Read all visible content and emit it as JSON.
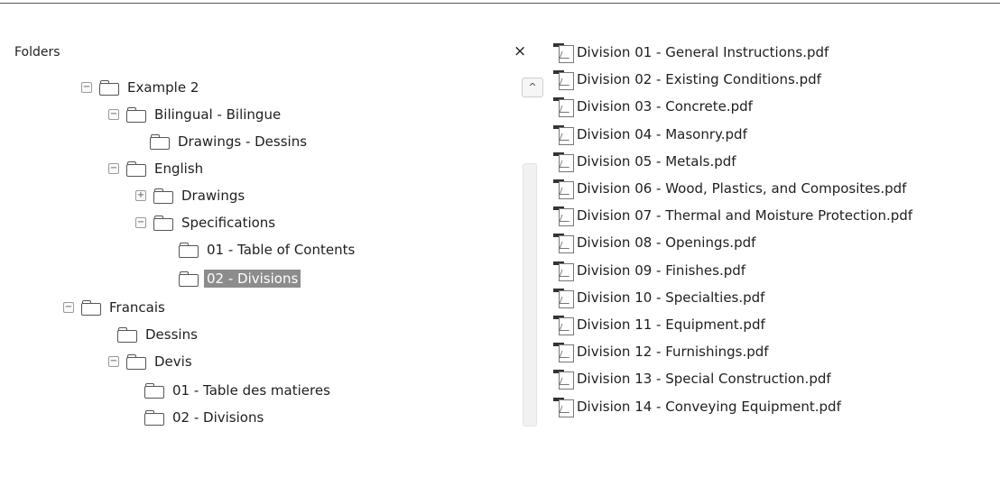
{
  "folders_pane": {
    "title": "Folders",
    "close": "×",
    "scroll_up": "^"
  },
  "tree": [
    {
      "label": "Example 2",
      "expander": "−"
    },
    {
      "label": "Bilingual - Bilingue",
      "expander": "−"
    },
    {
      "label": "Drawings - Dessins",
      "expander": ""
    },
    {
      "label": "English",
      "expander": "−"
    },
    {
      "label": "Drawings",
      "expander": "+"
    },
    {
      "label": "Specifications",
      "expander": "−"
    },
    {
      "label": "01 - Table of Contents",
      "expander": ""
    },
    {
      "label": "02 - Divisions",
      "expander": "",
      "selected": true
    },
    {
      "label": "Francais",
      "expander": "−"
    },
    {
      "label": "Dessins",
      "expander": ""
    },
    {
      "label": "Devis",
      "expander": "−"
    },
    {
      "label": "01 - Table des matieres",
      "expander": ""
    },
    {
      "label": "02 - Divisions",
      "expander": ""
    }
  ],
  "files": [
    {
      "name": "Division 01 - General Instructions.pdf",
      "icon": "pdf-icon"
    },
    {
      "name": "Division 02 - Existing Conditions.pdf",
      "icon": "pdf-icon"
    },
    {
      "name": "Division 03 - Concrete.pdf",
      "icon": "pdf-icon"
    },
    {
      "name": "Division 04 - Masonry.pdf",
      "icon": "pdf-icon"
    },
    {
      "name": "Division 05 - Metals.pdf",
      "icon": "pdf-icon"
    },
    {
      "name": "Division 06 - Wood, Plastics, and Composites.pdf",
      "icon": "pdf-icon"
    },
    {
      "name": "Division 07 - Thermal and Moisture Protection.pdf",
      "icon": "pdf-icon"
    },
    {
      "name": "Division 08 - Openings.pdf",
      "icon": "pdf-icon"
    },
    {
      "name": "Division 09 - Finishes.pdf",
      "icon": "pdf-icon"
    },
    {
      "name": "Division 10 - Specialties.pdf",
      "icon": "pdf-icon"
    },
    {
      "name": "Division 11 - Equipment.pdf",
      "icon": "pdf-icon"
    },
    {
      "name": "Division 12 - Furnishings.pdf",
      "icon": "pdf-icon"
    },
    {
      "name": "Division 13 - Special Construction.pdf",
      "icon": "pdf-icon"
    },
    {
      "name": "Division 14 - Conveying Equipment.pdf",
      "icon": "pdf-icon"
    }
  ]
}
